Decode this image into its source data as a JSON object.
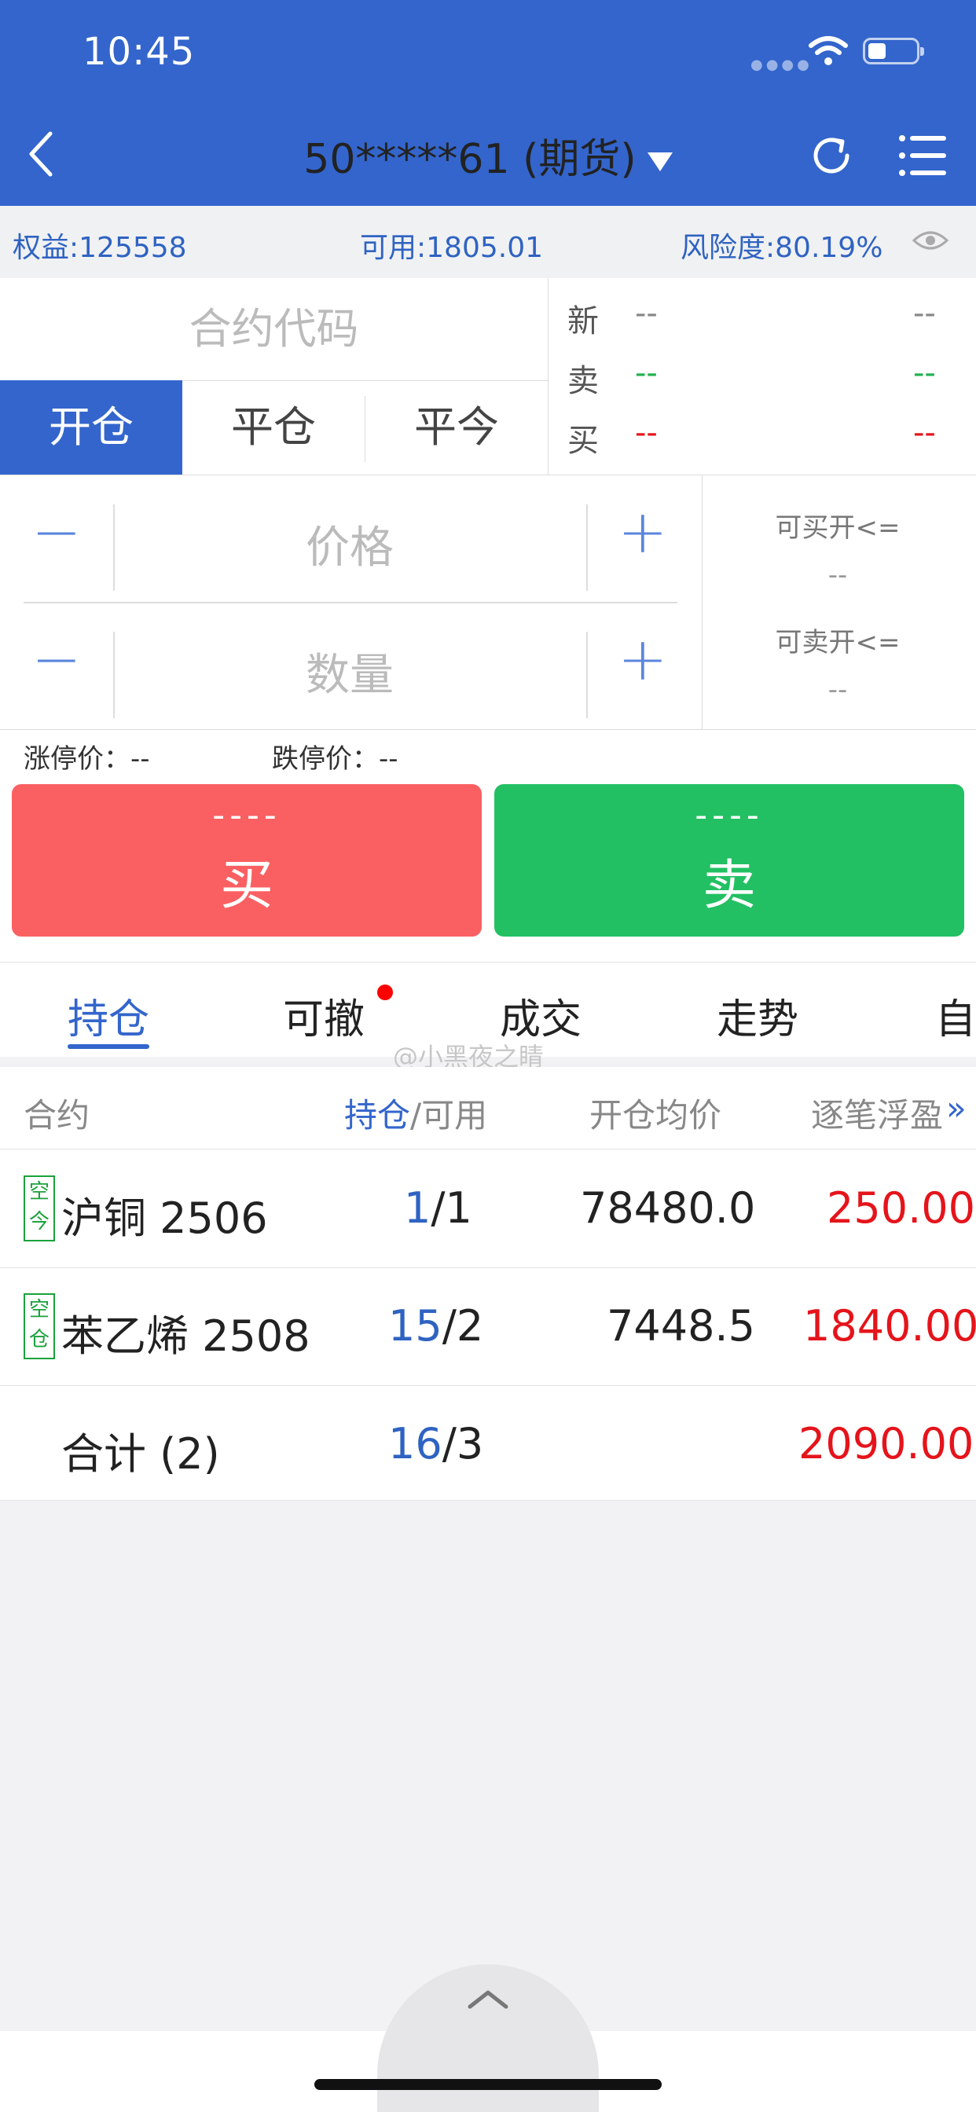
{
  "status": {
    "time": "10:45"
  },
  "nav": {
    "account": "50*****61 (期货)"
  },
  "summary": {
    "equity": "权益:125558",
    "available": "可用:1805.01",
    "risk": "风险度:80.19%"
  },
  "form": {
    "code_placeholder": "合约代码",
    "segments": [
      "开仓",
      "平仓",
      "平今"
    ],
    "quote": {
      "new_label": "新",
      "sell_label": "卖",
      "buy_label": "买",
      "dash": "--"
    },
    "price_placeholder": "价格",
    "qty_placeholder": "数量",
    "can_buy_label": "可买开<=",
    "can_buy_value": "--",
    "can_sell_label": "可卖开<=",
    "can_sell_value": "--",
    "limit_up": "涨停价：--",
    "limit_down": "跌停价：--",
    "buy": {
      "price": "----",
      "label": "买"
    },
    "sell": {
      "price": "----",
      "label": "卖"
    }
  },
  "tabs": [
    "持仓",
    "可撤",
    "成交",
    "走势",
    "自"
  ],
  "watermark": "@小黑夜之睛",
  "table": {
    "headers": {
      "contract": "合约",
      "pos": "持仓",
      "sep_avail": "/可用",
      "avg_price": "开仓均价",
      "pnl": "逐笔浮盈"
    },
    "rows": [
      {
        "badge_top": "空",
        "badge_bottom": "今",
        "name": "沪铜 2506",
        "pos": "1",
        "avail": "/1",
        "price": "78480.0",
        "pnl": "250.00"
      },
      {
        "badge_top": "空",
        "badge_bottom": "仓",
        "name": "苯乙烯 2508",
        "pos": "15",
        "avail": "/2",
        "price": "7448.5",
        "pnl": "1840.00"
      }
    ],
    "total": {
      "name": "合计 (2)",
      "pos": "16",
      "avail": "/3",
      "pnl": "2090.00"
    }
  },
  "colors": {
    "primary": "#3365cc",
    "buy": "#fa6062",
    "sell": "#22c063",
    "loss_red": "#e5141b"
  }
}
